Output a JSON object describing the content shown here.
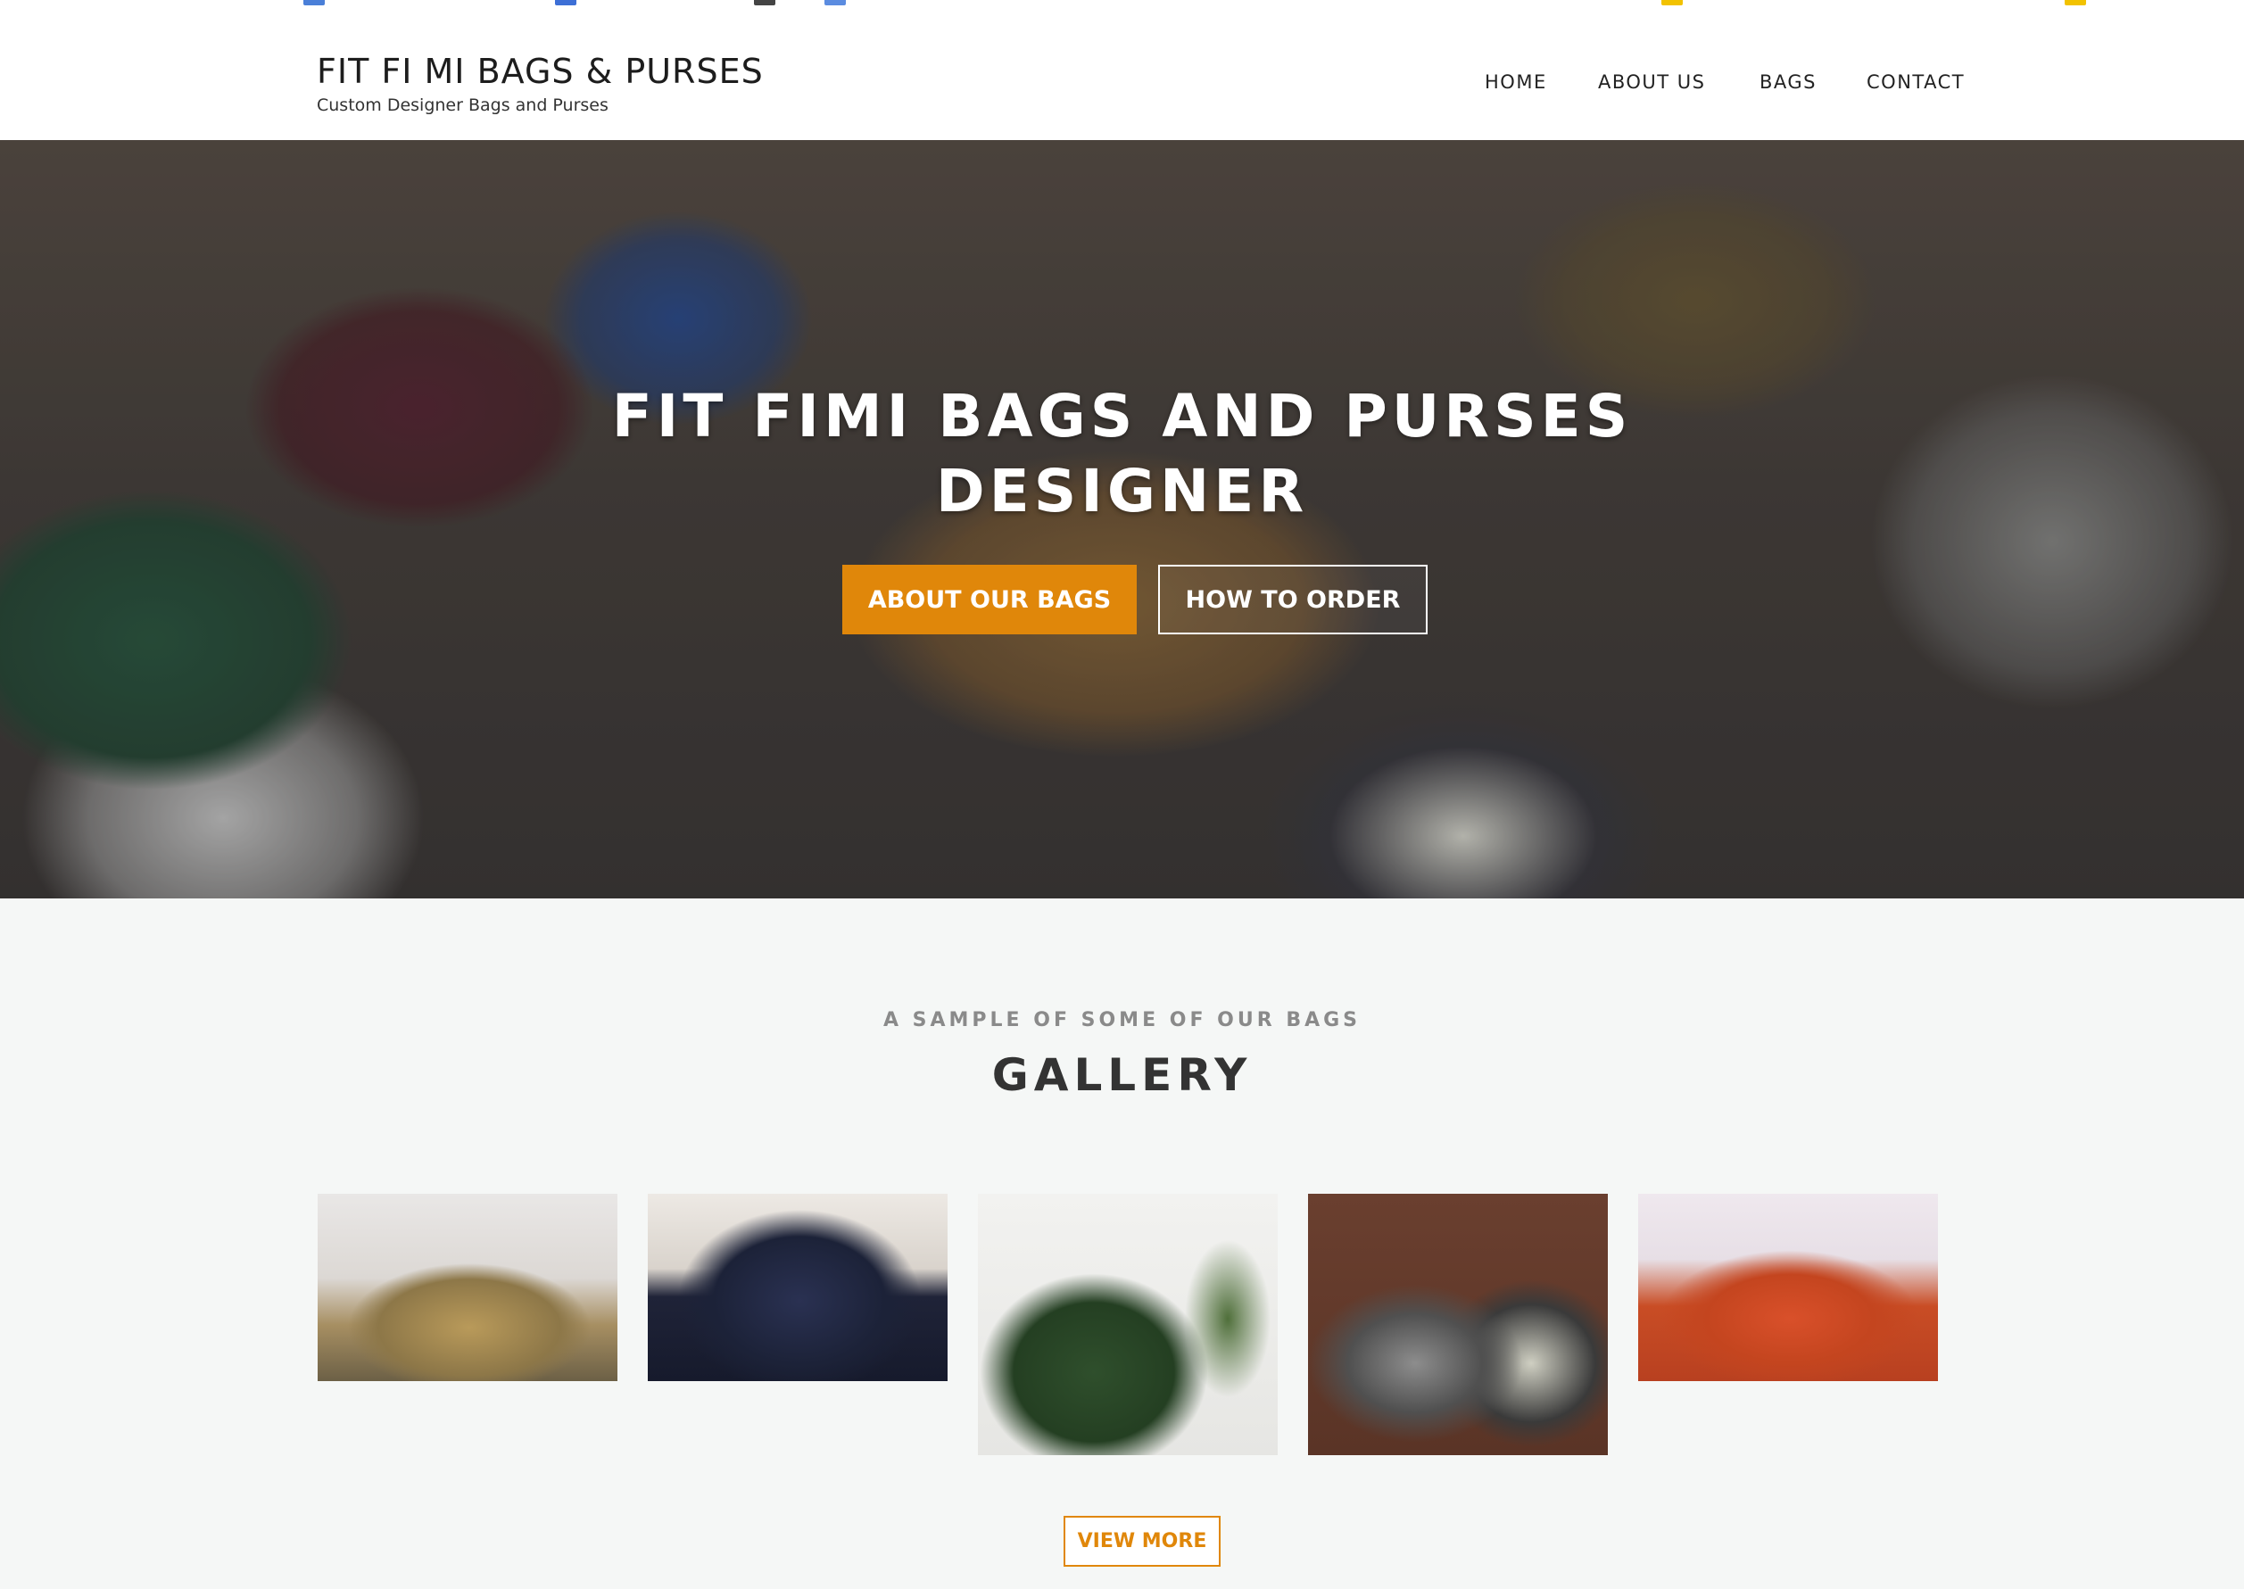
{
  "site": {
    "title": "FIT FI MI BAGS & PURSES",
    "tagline": "Custom Designer Bags and Purses"
  },
  "nav": {
    "home": "HOME",
    "about": "ABOUT US",
    "bags": "BAGS",
    "contact": "CONTACT"
  },
  "hero": {
    "title_line1": "FIT FIMI BAGS AND PURSES",
    "title_line2": "DESIGNER",
    "primary_button": "ABOUT OUR BAGS",
    "secondary_button": "HOW TO ORDER"
  },
  "gallery": {
    "subtitle": "A SAMPLE OF SOME OF OUR BAGS",
    "title": "GALLERY",
    "view_more": "VIEW MORE"
  },
  "colors": {
    "accent": "#e0870a",
    "header_bg": "#ffffff",
    "section_bg": "#f5f7f6"
  }
}
